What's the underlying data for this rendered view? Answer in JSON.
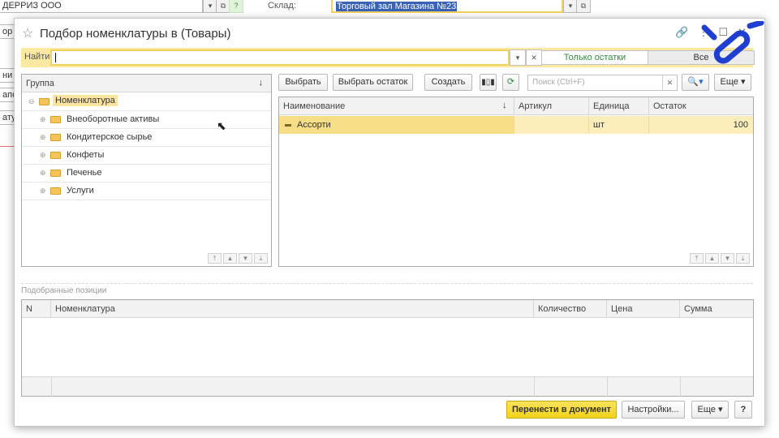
{
  "background_form": {
    "org_field": "ДЕРРИЗ ООО",
    "warehouse_label": "Склад:",
    "warehouse_value": "Торговый зал Магазина №23",
    "left_fragments": [
      "ор к",
      "ни тар",
      "апол",
      "атур"
    ]
  },
  "dialog": {
    "title": "Подбор номенклатуры в  (Товары)",
    "search_label": "Найти:",
    "search_value": "",
    "toggle_on": "Только остатки",
    "toggle_off": "Все"
  },
  "groups": {
    "header": "Группа",
    "header_sort": "↓",
    "root": "Номенклатура",
    "items": [
      "Внеоборотные активы",
      "Кондитерское сырье",
      "Конфеты",
      "Печенье",
      "Услуги"
    ]
  },
  "toolbar": {
    "select": "Выбрать",
    "select_remainder": "Выбрать остаток",
    "create": "Создать",
    "search_placeholder": "Поиск (Ctrl+F)",
    "more": "Еще"
  },
  "items_table": {
    "columns": [
      "Наименование",
      "Артикул",
      "Единица",
      "Остаток"
    ],
    "sort_marker": "↓",
    "rows": [
      {
        "name": "Ассорти",
        "article": "",
        "unit": "шт",
        "stock": "100"
      }
    ]
  },
  "selected": {
    "section_label": "Подобранные позиции",
    "columns": [
      "N",
      "Номенклатура",
      "Количество",
      "Цена",
      "Сумма"
    ]
  },
  "footer": {
    "transfer": "Перенести в документ",
    "settings": "Настройки...",
    "more": "Еще",
    "help": "?"
  },
  "colors": {
    "accent_yellow": "#f3d161",
    "selection": "#fbeeb8",
    "primary_button": "#f2d31b",
    "toggle_active_text": "#2e8a3e",
    "logo_blue": "#1f3fd1"
  }
}
